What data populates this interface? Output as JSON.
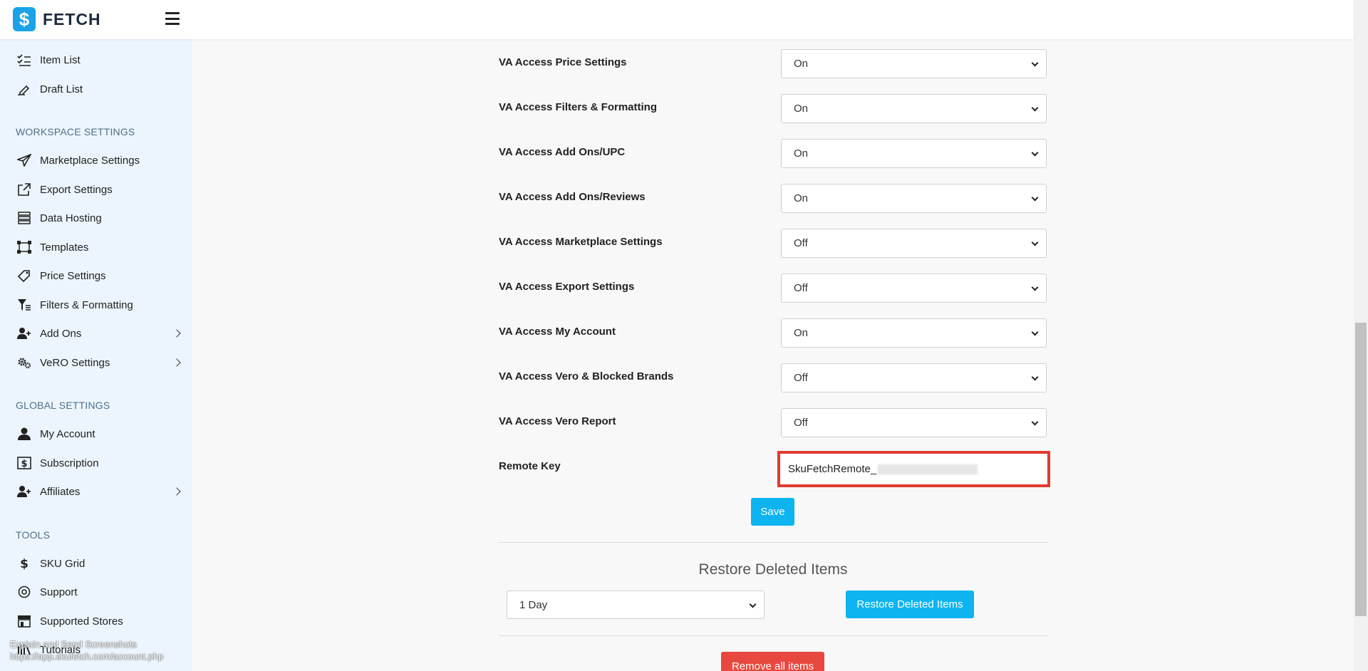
{
  "app": {
    "logo_text": "FETCH",
    "logo_glyph": "$"
  },
  "sidebar": {
    "top_items": [
      {
        "label": "Item List",
        "icon": "checklist-icon"
      },
      {
        "label": "Draft List",
        "icon": "edit-draft-icon"
      }
    ],
    "workspace_heading": "WORKSPACE SETTINGS",
    "workspace_items": [
      {
        "label": "Marketplace Settings",
        "icon": "paper-plane-icon"
      },
      {
        "label": "Export Settings",
        "icon": "external-link-icon"
      },
      {
        "label": "Data Hosting",
        "icon": "server-icon"
      },
      {
        "label": "Templates",
        "icon": "vector-square-icon"
      },
      {
        "label": "Price Settings",
        "icon": "price-tag-icon"
      },
      {
        "label": "Filters & Formatting",
        "icon": "filter-icon"
      },
      {
        "label": "Add Ons",
        "icon": "user-plus-icon"
      },
      {
        "label": "VeRO Settings",
        "icon": "gears-icon"
      }
    ],
    "global_heading": "GLOBAL SETTINGS",
    "global_items": [
      {
        "label": "My Account",
        "icon": "user-icon"
      },
      {
        "label": "Subscription",
        "icon": "dollar-box-icon"
      },
      {
        "label": "Affiliates",
        "icon": "user-plus-icon"
      }
    ],
    "tools_heading": "TOOLS",
    "tools_items": [
      {
        "label": "SKU Grid",
        "icon": "dollar-icon"
      },
      {
        "label": "Support",
        "icon": "support-icon"
      },
      {
        "label": "Supported Stores",
        "icon": "shop-icon"
      },
      {
        "label": "Tutorials",
        "icon": "tutorials-icon"
      }
    ]
  },
  "settings": {
    "rows": [
      {
        "label": "VA Access Price Settings",
        "value": "On"
      },
      {
        "label": "VA Access Filters & Formatting",
        "value": "On"
      },
      {
        "label": "VA Access Add Ons/UPC",
        "value": "On"
      },
      {
        "label": "VA Access Add Ons/Reviews",
        "value": "On"
      },
      {
        "label": "VA Access Marketplace Settings",
        "value": "Off"
      },
      {
        "label": "VA Access Export Settings",
        "value": "Off"
      },
      {
        "label": "VA Access My Account",
        "value": "On"
      },
      {
        "label": "VA Access Vero & Blocked Brands",
        "value": "Off"
      },
      {
        "label": "VA Access Vero Report",
        "value": "Off"
      }
    ],
    "remote_key_label": "Remote Key",
    "remote_key_value": "SkuFetchRemote_",
    "save_label": "Save"
  },
  "restore": {
    "title": "Restore Deleted Items",
    "period_value": "1 Day",
    "button_label": "Restore Deleted Items"
  },
  "remove_all_label": "Remove all items",
  "status_overlay": {
    "line1": "Explain and Send Screenshots",
    "line2": "https://app.skufetch.com/account.php"
  },
  "colors": {
    "accent": "#0db4ef",
    "danger": "#e8483f",
    "highlight": "#e03b32",
    "sidebar_bg": "#ecf5fd"
  }
}
